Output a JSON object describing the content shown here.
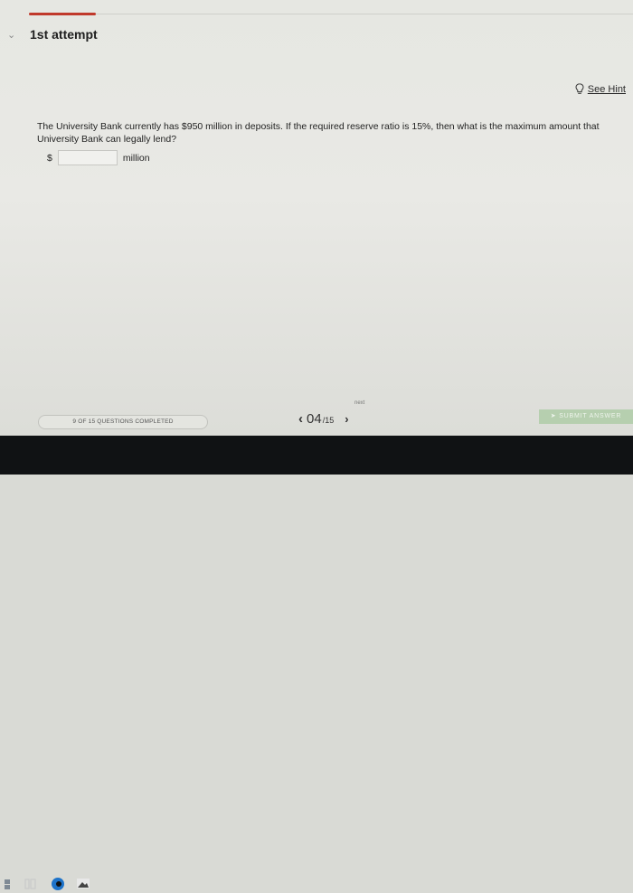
{
  "header": {
    "attempt_title": "1st attempt"
  },
  "hint": {
    "label": "See Hint"
  },
  "question": {
    "text": "The University Bank currently has $950 million in deposits. If the required reserve ratio is 15%, then what is the maximum amount that University Bank can legally lend?",
    "answer_prefix": "$",
    "answer_value": "",
    "answer_suffix": "million"
  },
  "footer": {
    "progress_text": "9 OF 15 QUESTIONS COMPLETED",
    "current_page": "04",
    "total_pages": "/15",
    "next_tooltip": "next",
    "submit_label": "SUBMIT ANSWER"
  },
  "colors": {
    "accent": "#c0392b",
    "submit_bg": "#b6cfaf"
  },
  "icons": [
    "chevron-down-icon",
    "lightbulb-icon",
    "prev-arrow-icon",
    "next-arrow-icon",
    "submit-arrow-icon",
    "task-view-icon",
    "edge-browser-icon",
    "photos-icon"
  ]
}
